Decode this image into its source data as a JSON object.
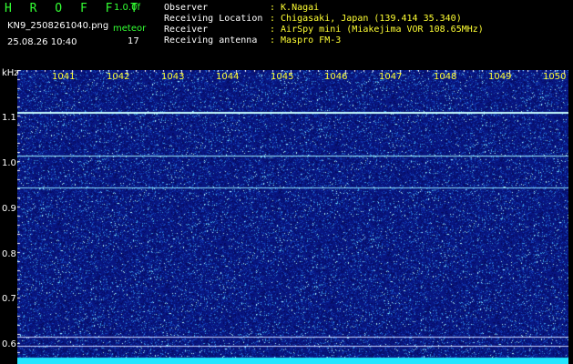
{
  "header": {
    "title": "H R O F F T",
    "version": "1.0.0f",
    "filename": "KN9_2508261040.png",
    "datetime": "25.08.26 10:40",
    "meteor_label": "meteor",
    "meteor_count": "17",
    "fields": [
      {
        "label": "Observer",
        "value": ": K.Nagai"
      },
      {
        "label": "Receiving Location",
        "value": ": Chigasaki, Japan (139.414 35.340)"
      },
      {
        "label": "Receiver",
        "value": ": AirSpy mini (Miakejima VOR 108.65MHz)"
      },
      {
        "label": "Receiving antenna",
        "value": ": Maspro FM-3"
      }
    ]
  },
  "axes": {
    "y_unit": "kHz",
    "y_ticks": [
      "1.1",
      "1.0",
      "0.9",
      "0.8",
      "0.7",
      "0.6"
    ],
    "x_ticks": [
      "1041",
      "1042",
      "1043",
      "1044",
      "1045",
      "1046",
      "1047",
      "1048",
      "1049",
      "1050"
    ]
  },
  "colors": {
    "background": "#000000",
    "spectrum_base": "#0b1a8a",
    "label_green": "#33ff33",
    "label_yellow": "#ffff33",
    "signal_cyan": "#aaffff"
  }
}
